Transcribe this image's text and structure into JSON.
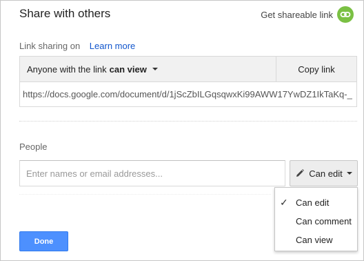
{
  "dialog": {
    "title": "Share with others",
    "get_link_label": "Get shareable link",
    "get_link_icon": "link-icon"
  },
  "link_sharing": {
    "label": "Link sharing on",
    "learn_more": "Learn more",
    "access_prefix": "Anyone with the link",
    "access_level": "can view",
    "copy_label": "Copy link",
    "url": "https://docs.google.com/document/d/1jScZbILGqsqwxKi99AWW17YwDZ1IkTaKq-_"
  },
  "people": {
    "label": "People",
    "input_placeholder": "Enter names or email addresses...",
    "input_value": "",
    "permission_label": "Can edit",
    "permission_icon": "pencil-icon"
  },
  "permission_menu": {
    "items": [
      {
        "label": "Can edit",
        "checked": true
      },
      {
        "label": "Can comment",
        "checked": false
      },
      {
        "label": "Can view",
        "checked": false
      }
    ]
  },
  "footer": {
    "done_label": "Done"
  },
  "colors": {
    "accent_blue": "#4d90fe",
    "link_blue": "#1155cc",
    "link_icon_green": "#7ac043"
  }
}
